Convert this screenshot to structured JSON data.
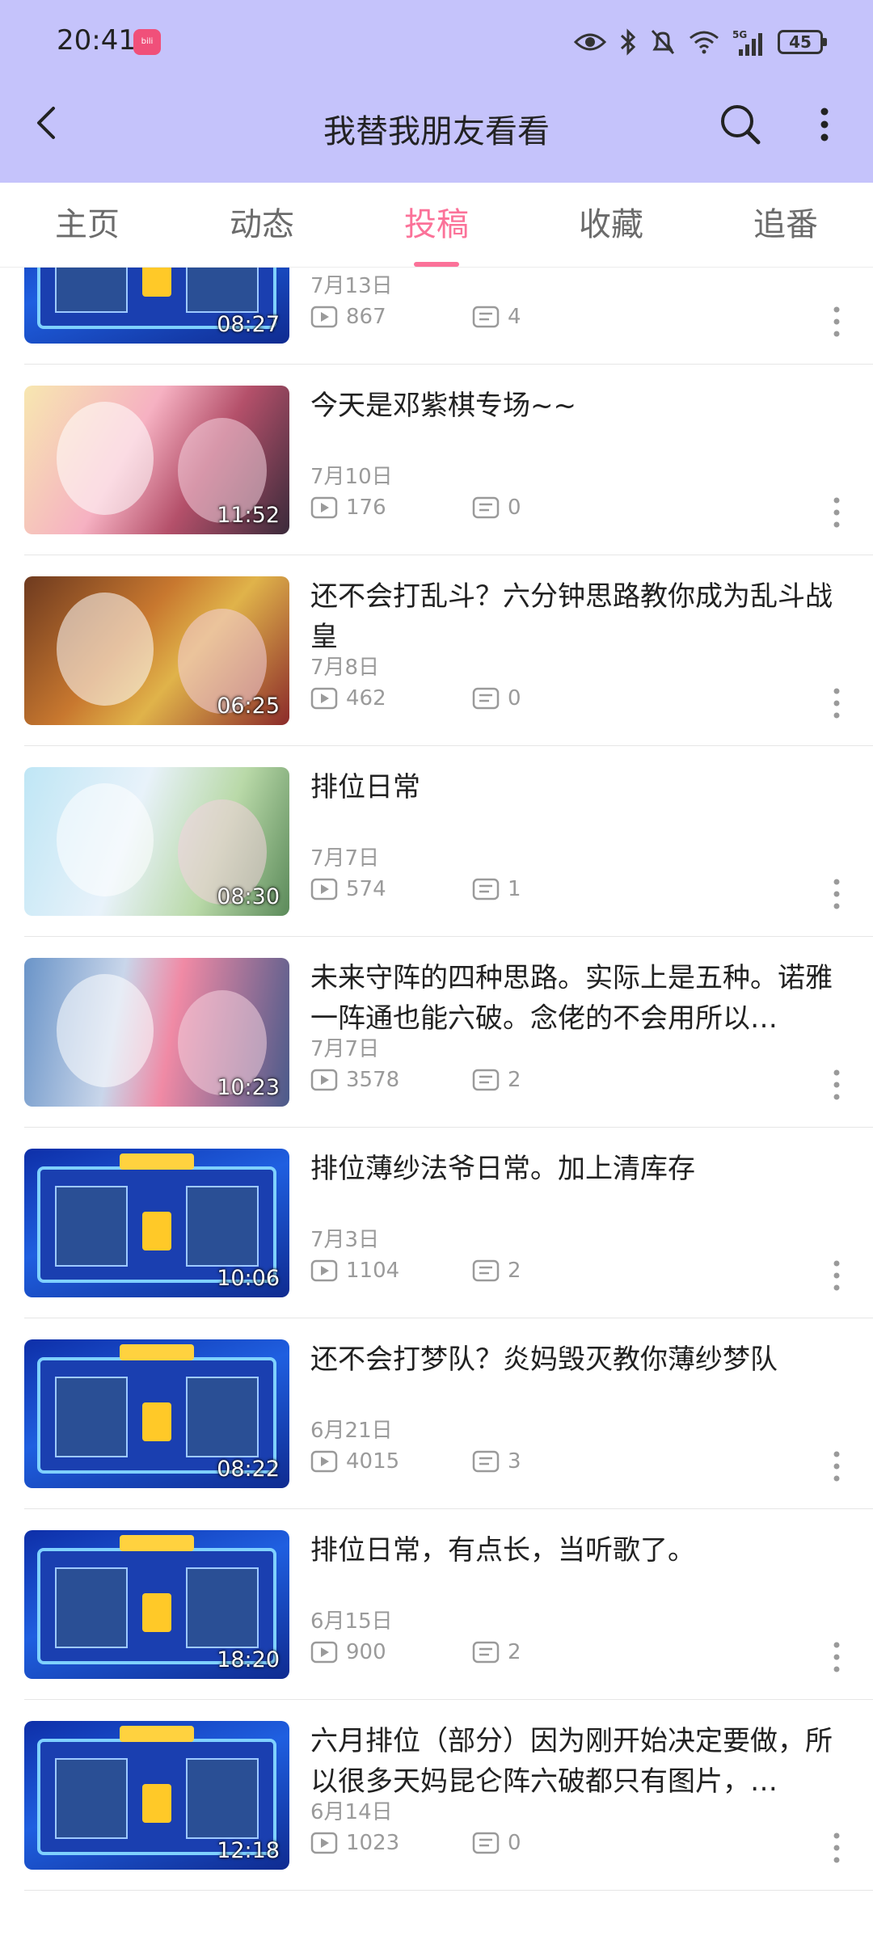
{
  "status_bar": {
    "time": "20:41",
    "battery": "45",
    "network": "5G",
    "icons": [
      "app-badge-icon",
      "eye-icon",
      "bluetooth-icon",
      "bell-muted-icon",
      "wifi-icon",
      "signal-icon",
      "battery-icon"
    ]
  },
  "app_bar": {
    "title": "我替我朋友看看",
    "icons": [
      "back-arrow-icon",
      "search-icon",
      "more-vertical-icon"
    ]
  },
  "tabs": [
    {
      "label": "主页",
      "active": false
    },
    {
      "label": "动态",
      "active": false
    },
    {
      "label": "投稿",
      "active": true
    },
    {
      "label": "收藏",
      "active": false
    },
    {
      "label": "追番",
      "active": false
    }
  ],
  "theme": {
    "header_bg": "#c5c3fb",
    "accent": "#fb7299"
  },
  "videos": [
    {
      "title": "",
      "date": "7月13日",
      "views": "867",
      "comments": "4",
      "duration": "08:27",
      "thumb": "board"
    },
    {
      "title": "今天是邓紫棋专场~~",
      "date": "7月10日",
      "views": "176",
      "comments": "0",
      "duration": "11:52",
      "thumb": "anime1"
    },
    {
      "title": "还不会打乱斗？六分钟思路教你成为乱斗战皇",
      "date": "7月8日",
      "views": "462",
      "comments": "0",
      "duration": "06:25",
      "thumb": "party"
    },
    {
      "title": "排位日常",
      "date": "7月7日",
      "views": "574",
      "comments": "1",
      "duration": "08:30",
      "thumb": "anime2"
    },
    {
      "title": "未来守阵的四种思路。实际上是五种。诺雅一阵通也能六破。念佬的不会用所以…",
      "date": "7月7日",
      "views": "3578",
      "comments": "2",
      "duration": "10:23",
      "thumb": "anime3"
    },
    {
      "title": "排位薄纱法爷日常。加上清库存",
      "date": "7月3日",
      "views": "1104",
      "comments": "2",
      "duration": "10:06",
      "thumb": "board"
    },
    {
      "title": "还不会打梦队？炎妈毁灭教你薄纱梦队",
      "date": "6月21日",
      "views": "4015",
      "comments": "3",
      "duration": "08:22",
      "thumb": "board"
    },
    {
      "title": "排位日常，有点长，当听歌了。",
      "date": "6月15日",
      "views": "900",
      "comments": "2",
      "duration": "18:20",
      "thumb": "board"
    },
    {
      "title": "六月排位（部分）因为刚开始决定要做，所以很多天妈昆仑阵六破都只有图片，…",
      "date": "6月14日",
      "views": "1023",
      "comments": "0",
      "duration": "12:18",
      "thumb": "board"
    }
  ]
}
